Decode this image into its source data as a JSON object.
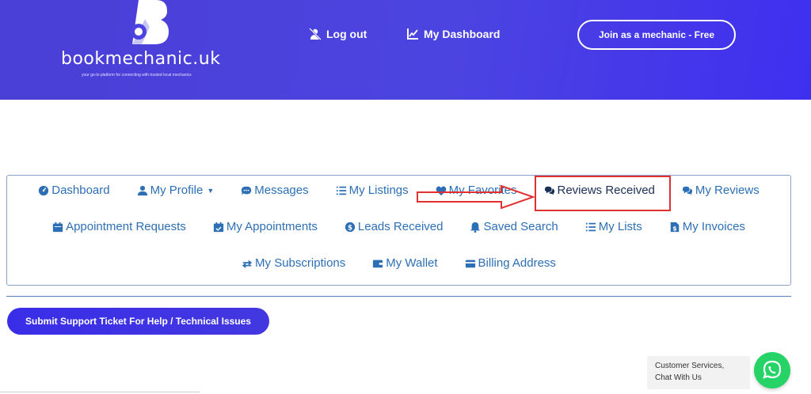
{
  "header": {
    "logo_text": "bookmechanic.uk",
    "logo_tagline": "your go-to platform for connecting with trusted local mechanics",
    "logout_label": "Log out",
    "dashboard_label": "My Dashboard",
    "join_label": "Join as a mechanic - Free"
  },
  "menu": {
    "row1": [
      "Dashboard",
      "My Profile",
      "Messages",
      "My Listings",
      "My Favorites",
      "Reviews Received",
      "My Reviews"
    ],
    "row2": [
      "Appointment Requests",
      "My Appointments",
      "Leads Received",
      "Saved Search",
      "My Lists",
      "My Invoices"
    ],
    "row3": [
      "My Subscriptions",
      "My Wallet",
      "Billing Address"
    ],
    "active": "Reviews Received"
  },
  "support_label": "Submit Support Ticket For Help / Technical Issues",
  "chat": {
    "label": "Customer Services, Chat With Us"
  },
  "colors": {
    "header": "#4c44e0",
    "link": "#2d6fb5",
    "highlight": "#e23030",
    "whatsapp": "#25d366"
  }
}
